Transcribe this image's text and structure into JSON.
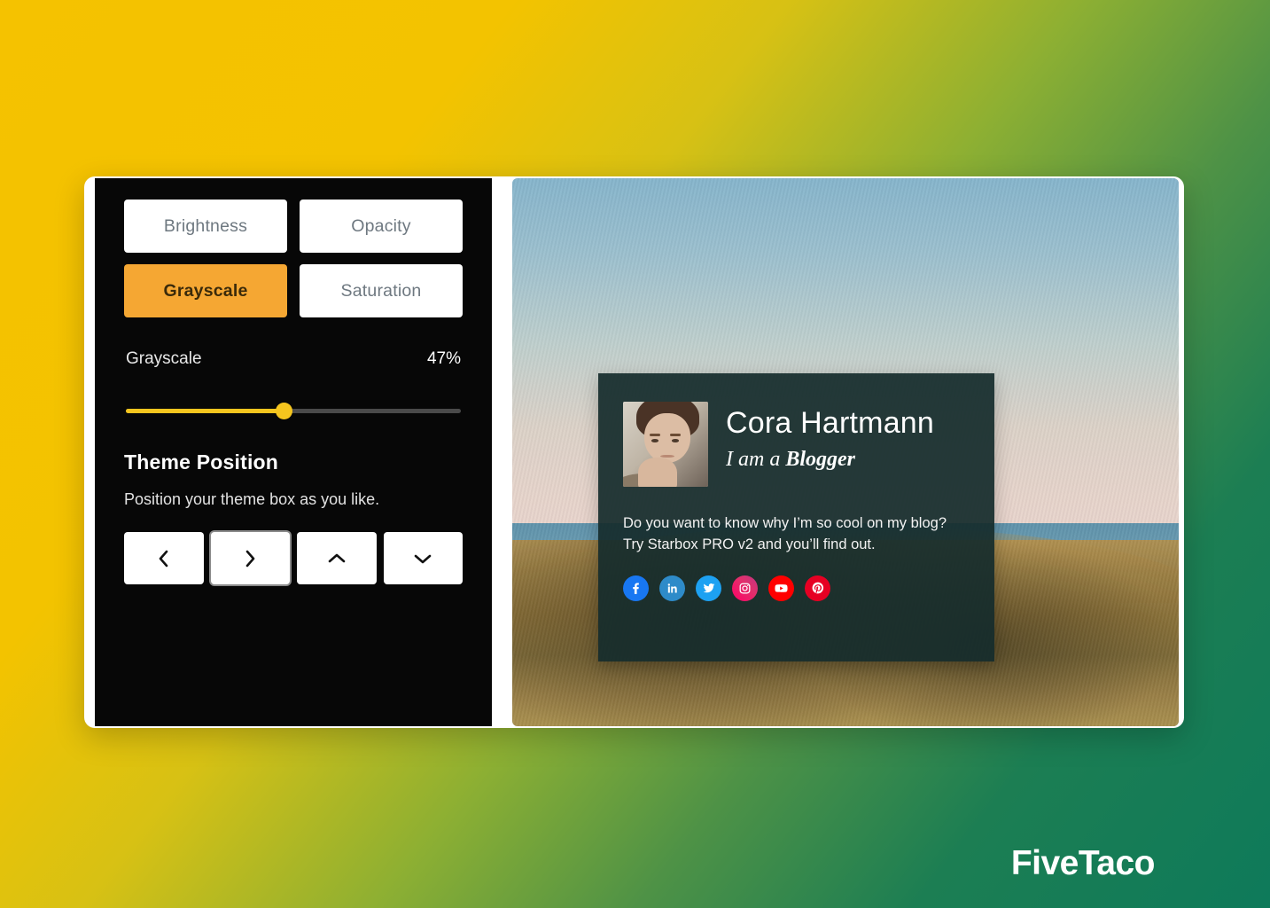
{
  "brand": {
    "watermark": "FiveTaco"
  },
  "colors": {
    "accent_orange": "#F5A733",
    "slider_yellow": "#F5C51E",
    "panel_black": "#070707",
    "card_dark_teal": "#162C2C",
    "bg_gradient_start": "#F5C200",
    "bg_gradient_end": "#0E7A5A"
  },
  "panel": {
    "tabs": [
      {
        "label": "Brightness",
        "active": false
      },
      {
        "label": "Opacity",
        "active": false
      },
      {
        "label": "Grayscale",
        "active": true
      },
      {
        "label": "Saturation",
        "active": false
      }
    ],
    "slider": {
      "label": "Grayscale",
      "value_label": "47%",
      "value": 47,
      "min": 0,
      "max": 100
    },
    "theme_position": {
      "title": "Theme Position",
      "description": "Position your theme box as you like.",
      "buttons": [
        {
          "name": "move-left",
          "glyph": "chevron-left-icon",
          "focused": false
        },
        {
          "name": "move-right",
          "glyph": "chevron-right-icon",
          "focused": true
        },
        {
          "name": "move-up",
          "glyph": "chevron-up-icon",
          "focused": false
        },
        {
          "name": "move-down",
          "glyph": "chevron-down-icon",
          "focused": false
        }
      ]
    }
  },
  "preview": {
    "card": {
      "name": "Cora Hartmann",
      "tagline_prefix": "I am a ",
      "tagline_strong": "Blogger",
      "description_line1": "Do you want to know why I’m so cool on my blog?",
      "description_line2": "Try Starbox PRO v2 and you’ll find out.",
      "avatar_alt": "avatar-photo",
      "socials": [
        {
          "name": "facebook",
          "color": "#1877F2"
        },
        {
          "name": "linkedin",
          "color": "#2E8BC9"
        },
        {
          "name": "twitter",
          "color": "#1DA1F2"
        },
        {
          "name": "instagram",
          "color": "#E1306C"
        },
        {
          "name": "youtube",
          "color": "#FF0000"
        },
        {
          "name": "pinterest",
          "color": "#E60023"
        }
      ]
    }
  }
}
